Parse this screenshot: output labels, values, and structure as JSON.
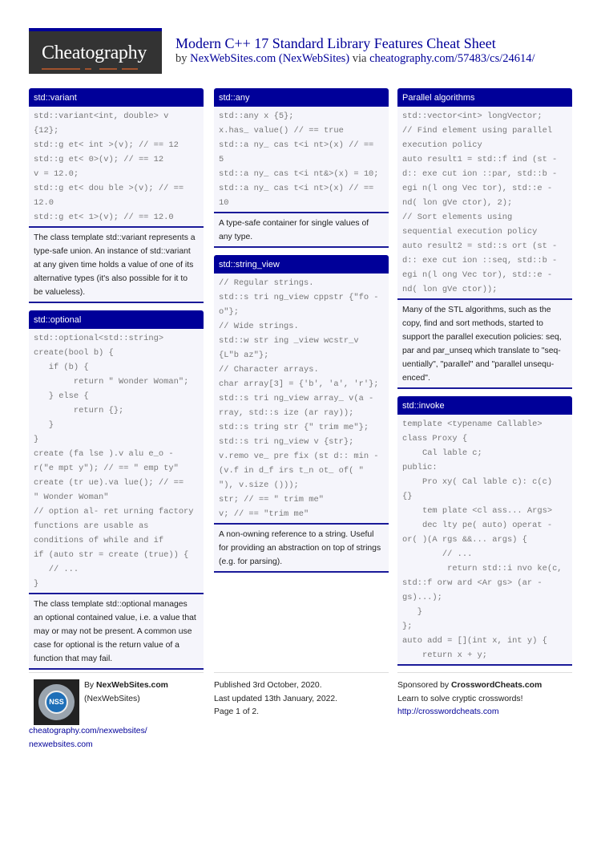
{
  "header": {
    "logo": "Cheatography",
    "title": "Modern C++ 17 Standard Library Features Cheat Sheet",
    "by_prefix": "by",
    "author": "NexWebSites.com (NexWebSites)",
    "via": "via",
    "url": "cheatography.com/57483/cs/24614/"
  },
  "colors": {
    "accent": "#000099",
    "logo_bg": "#333333",
    "underline": "#a0522d",
    "panel_bg": "#f5f5fb"
  },
  "sections": {
    "variant": {
      "title": "std::variant",
      "code": "std::variant<int, double> v\n{12};\nstd::g et< int >(v); // == 12\nstd::g et< 0>(v); // == 12\nv = 12.0;\nstd::g et< dou ble >(v); // ==\n12.0\nstd::g et< 1>(v); // == 12.0",
      "desc": "The class template std::variant represents a type-safe union. An instance of std::variant at any given time holds a value of one of its alternative types (it's also possible for it to be valueless)."
    },
    "optional": {
      "title": "std::optional",
      "code": "std::optional<std::string>\ncreate(bool b) {\n   if (b) {\n        return \" Wonder Woman\";\n   } else {\n        return {};\n   }\n}\ncreate (fa lse ).v alu e_o -\nr(\"e mpt y\"); // == \" emp ty\"\ncreate (tr ue).va lue(); // ==\n\" Wonder Woman\"\n// option al- ret urning factory\nfunctions are usable as\nconditions of while and if\nif (auto str = create (true)) {\n   // ...\n}",
      "desc": "The class template std::optional manages an optional contained value, i.e. a value that may or may not be present. A common use case for optional is the return value of a function that may fail."
    },
    "any": {
      "title": "std::any",
      "code": "std::any x {5};\nx.has_ value() // == true\nstd::a ny_ cas t<i nt>(x) // ==\n5\nstd::a ny_ cas t<i nt&>(x) = 10;\nstd::a ny_ cas t<i nt>(x) // ==\n10",
      "desc": "A type-safe container for single values of any type."
    },
    "string_view": {
      "title": "std::string_view",
      "code": "// Regular strings.\nstd::s tri ng_view cppstr {\"fo -\no\"};\n// Wide strings.\nstd::w str ing _view wcstr_v\n{L\"b az\"};\n// Character arrays.\nchar array[3] = {'b', 'a', 'r'};\nstd::s tri ng_view array_ v(a -\nrray, std::s ize (ar ray));\nstd::s tring str {\" trim me\"};\nstd::s tri ng_view v {str};\nv.remo ve_ pre fix (st d:: min -\n(v.f in d_f irs t_n ot_ of( \"\n\"), v.size ()));\nstr; // == \" trim me\"\nv; // == \"trim me\"",
      "desc": "A non-owning reference to a string. Useful for providing an abstraction on top of strings (e.g. for parsing)."
    },
    "parallel": {
      "title": "Parallel algorithms",
      "code": "std::vector<int> longVector;\n// Find element using parallel\nexecution policy\nauto result1 = std::f ind (st -\nd:: exe cut ion ::par, std::b -\negi n(l ong Vec tor), std::e -\nnd( lon gVe ctor), 2);\n// Sort elements using\nsequential execution policy\nauto result2 = std::s ort (st -\nd:: exe cut ion ::seq, std::b -\negi n(l ong Vec tor), std::e -\nnd( lon gVe ctor));",
      "desc": "Many of the STL algorithms, such as the copy, find and sort methods, started to support the parallel execution policies: seq, par and par_unseq which translate to \"seq-uentially\", \"parallel\" and \"parallel unsequ-enced\"."
    },
    "invoke": {
      "title": "std::invoke",
      "code": "template <typename Callable>\nclass Proxy {\n    Cal lable c;\npublic:\n    Pro xy( Cal lable c): c(c)\n{}\n    tem plate <cl ass... Args>\n    dec lty pe( auto) operat -\nor( )(A rgs &&... args) {\n        // ...\n         return std::i nvo ke(c,\nstd::f orw ard <Ar gs> (ar -\ngs)...);\n   }\n};\nauto add = [](int x, int y) {\n    return x + y;"
    }
  },
  "footer": {
    "author_prefix": "By",
    "author_name": "NexWebSites.com",
    "author_handle": "(NexWebSites)",
    "avatar_text": "NSS",
    "link1": "cheatography.com/nexwebsites/",
    "link2": "nexwebsites.com",
    "published": "Published 3rd October, 2020.",
    "updated": "Last updated 13th January, 2022.",
    "page": "Page 1 of 2.",
    "sponsor_prefix": "Sponsored by",
    "sponsor_name": "CrosswordCheats.com",
    "sponsor_tagline": "Learn to solve cryptic crosswords!",
    "sponsor_url": "http://crosswordcheats.com"
  }
}
